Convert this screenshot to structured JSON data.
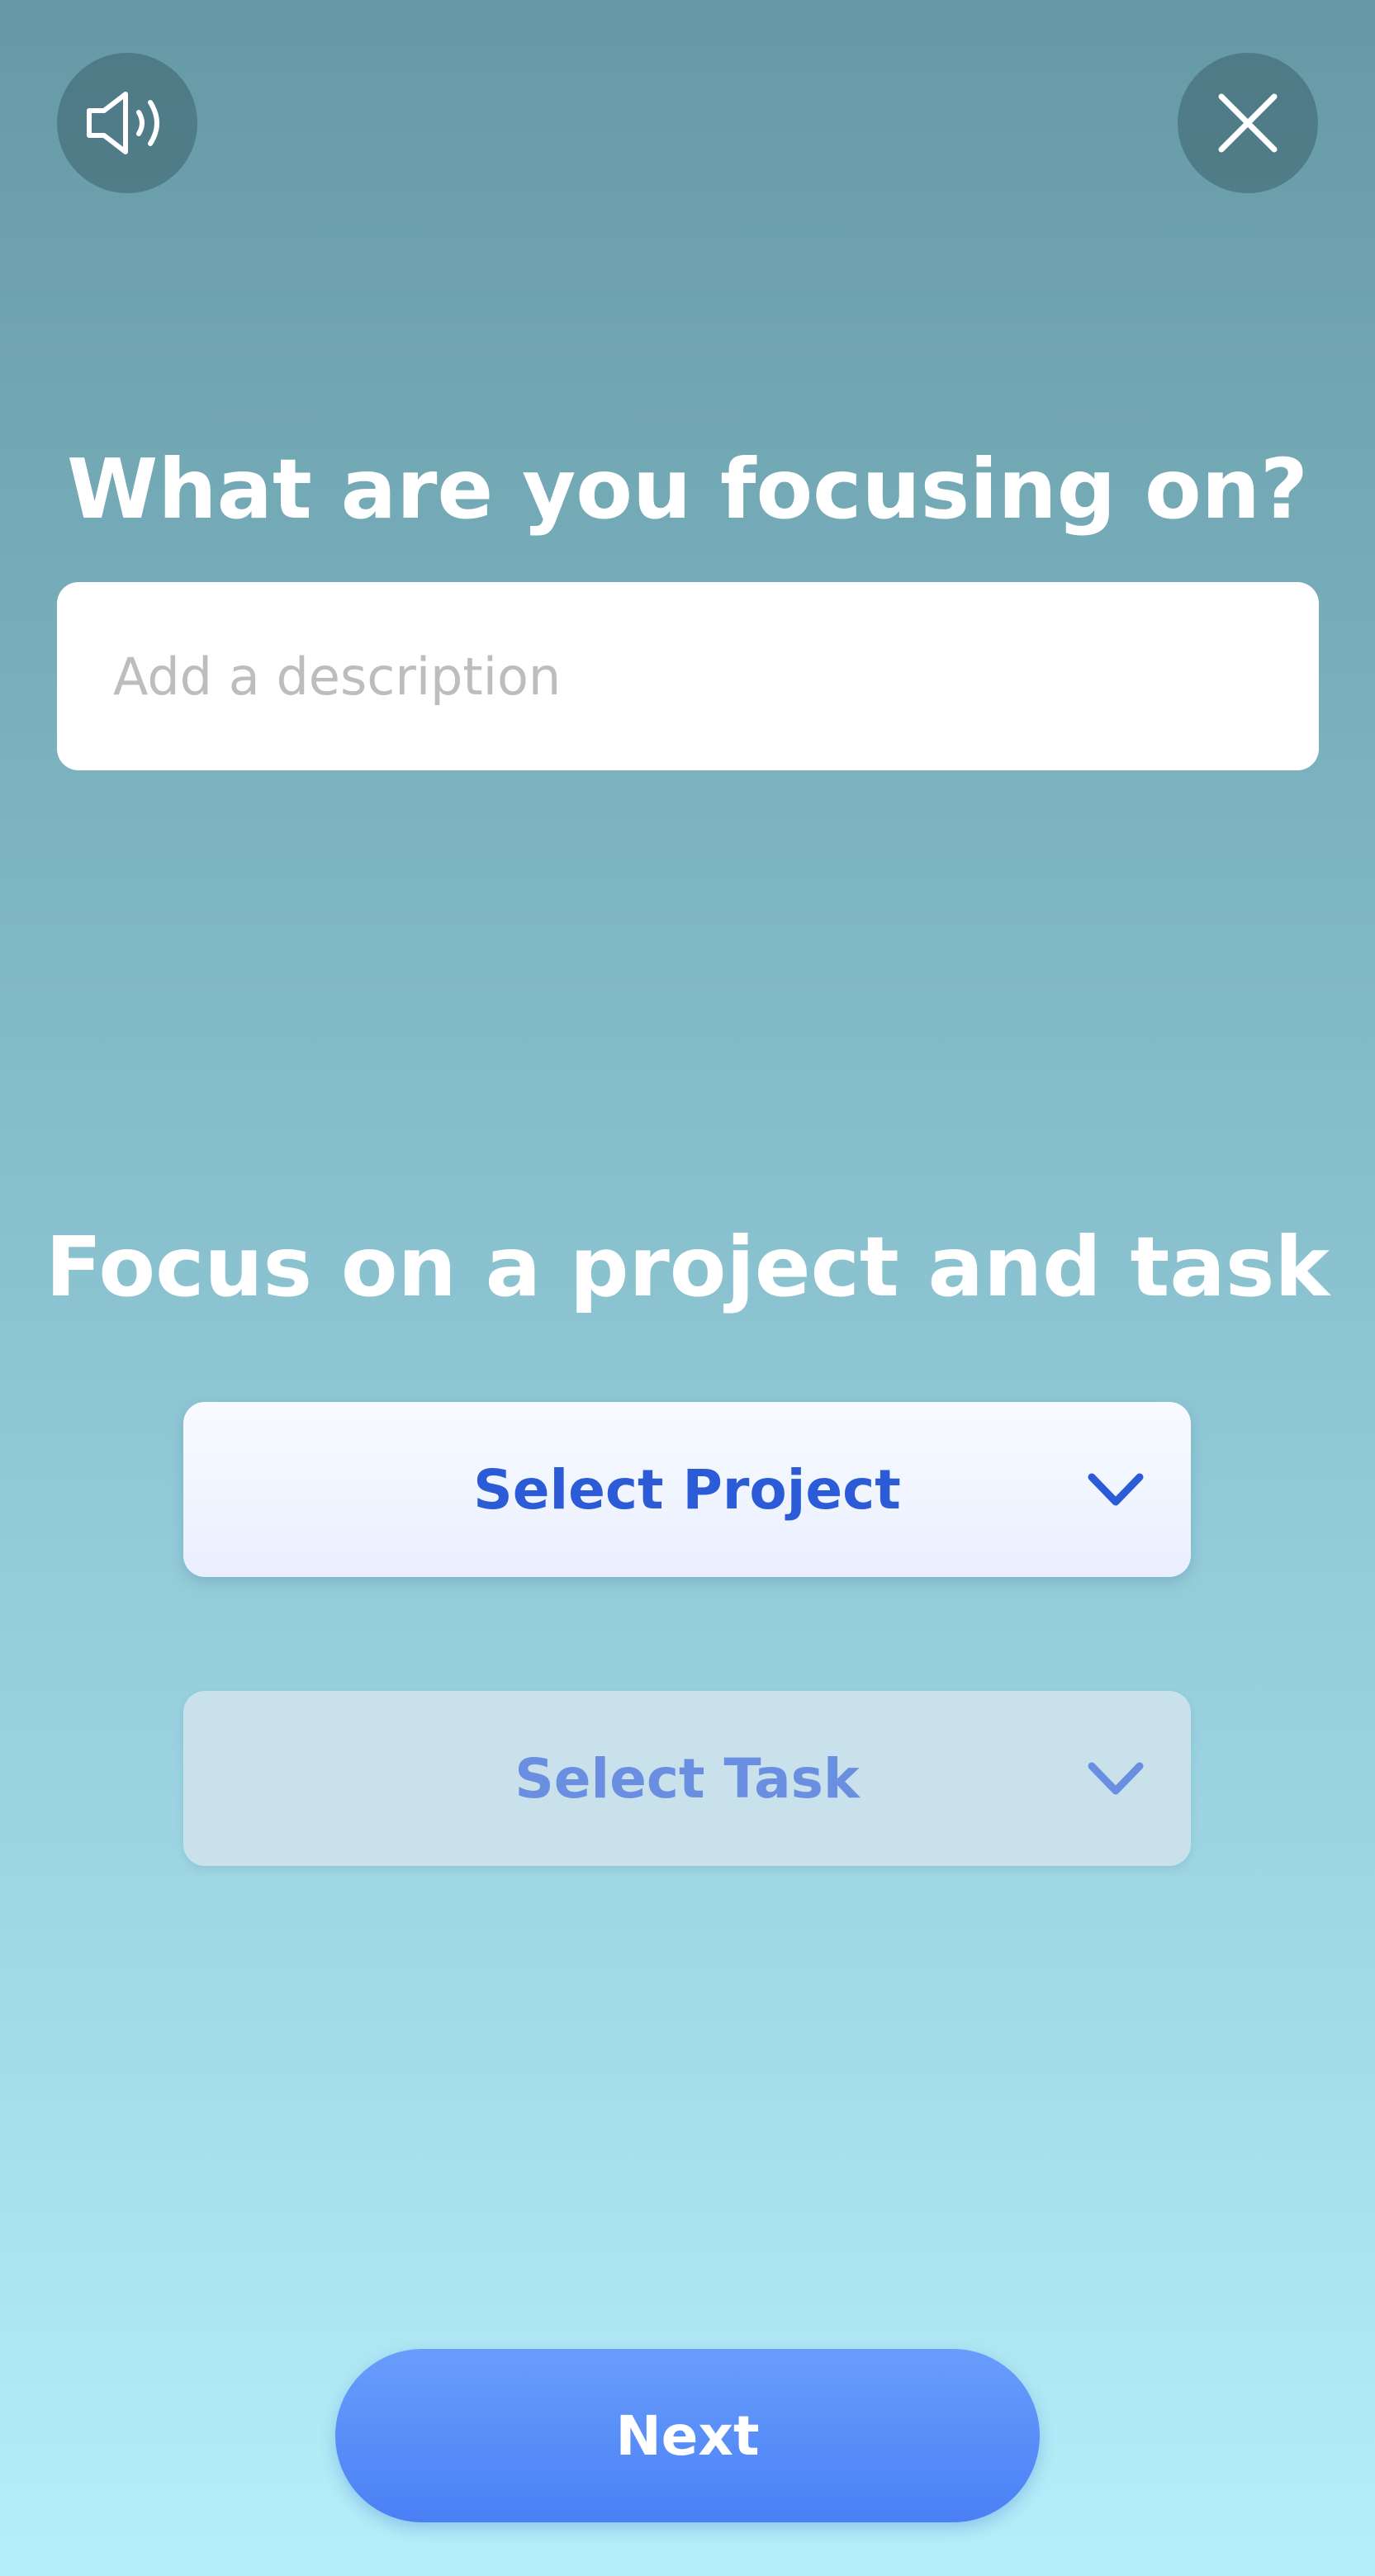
{
  "header": {
    "sound_icon": "speaker-volume-icon",
    "close_icon": "close-x-icon"
  },
  "description_section": {
    "title": "What are you focusing on?",
    "input_placeholder": "Add a description",
    "input_value": ""
  },
  "project_section": {
    "title": "Focus on a project and task",
    "project_select": {
      "label": "Select Project",
      "icon": "chevron-down-icon"
    },
    "task_select": {
      "label": "Select Task",
      "icon": "chevron-down-icon",
      "disabled": true
    }
  },
  "footer": {
    "next_label": "Next"
  },
  "colors": {
    "background_top": "#6699a6",
    "background_bottom": "#b6eefa",
    "accent_blue": "#2b5bd6",
    "next_button": "#4a80f5"
  }
}
